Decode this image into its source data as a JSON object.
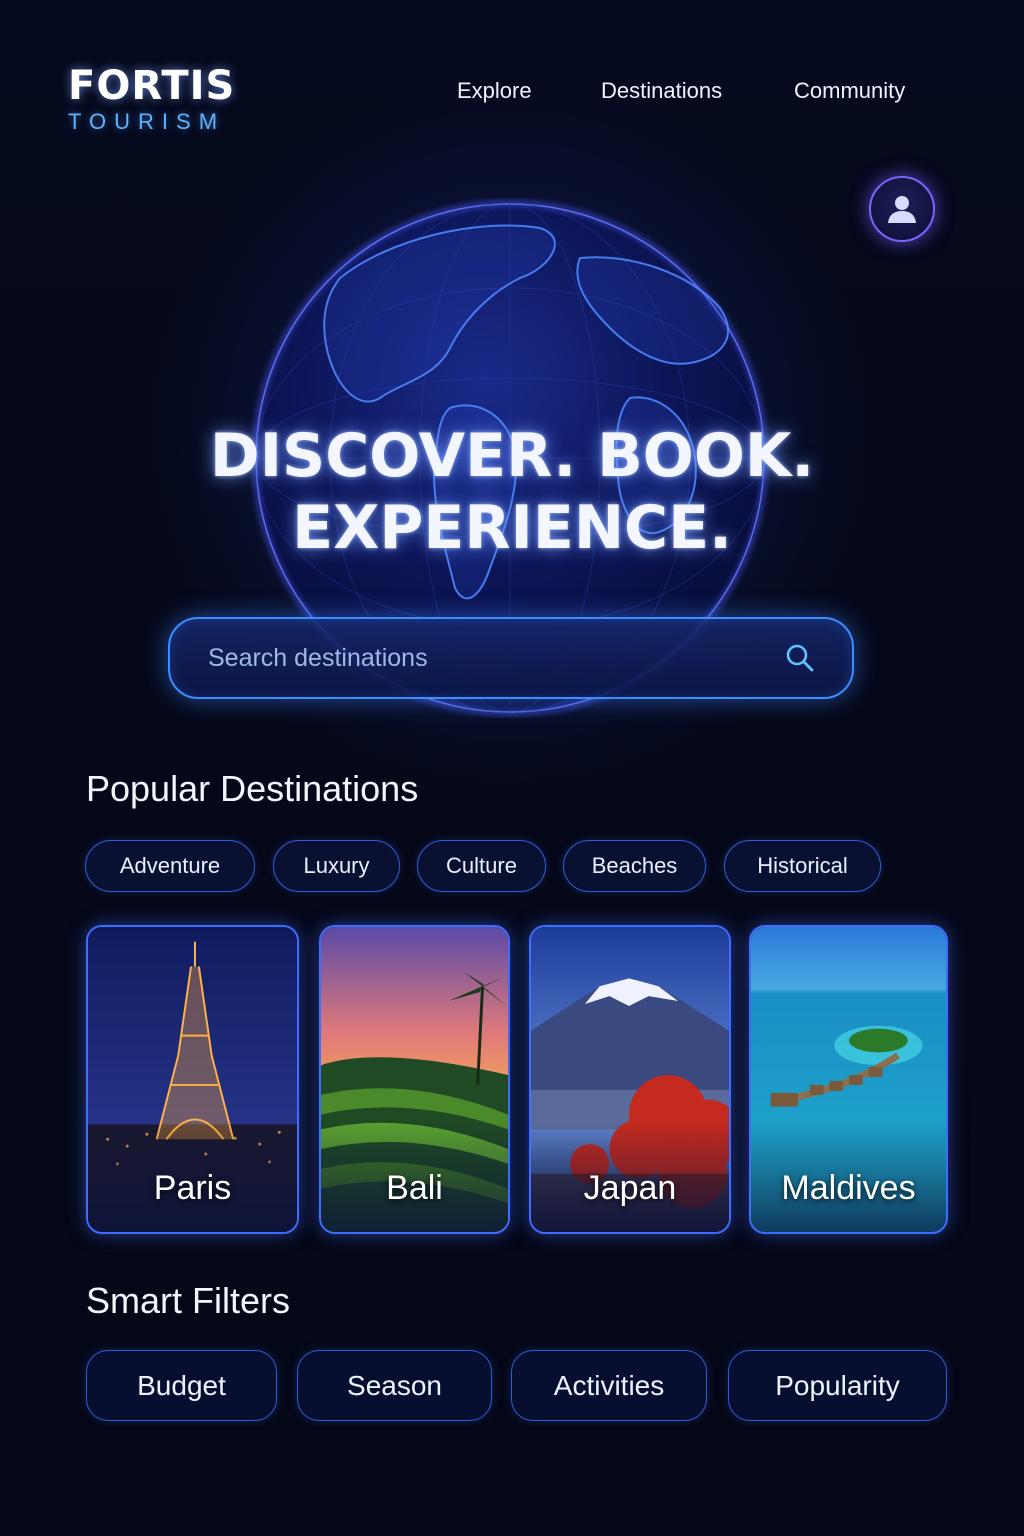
{
  "brand": {
    "name": "FORTIS",
    "tagline": "TOURISM"
  },
  "nav": {
    "items": [
      "Explore",
      "Destinations",
      "Community"
    ]
  },
  "hero": {
    "line1": "DISCOVER. BOOK.",
    "line2": "EXPERIENCE."
  },
  "search": {
    "placeholder": "Search destinations",
    "value": ""
  },
  "popular": {
    "title": "Popular Destinations",
    "categories": [
      "Adventure",
      "Luxury",
      "Culture",
      "Beaches",
      "Historical"
    ],
    "destinations": [
      {
        "name": "Paris",
        "image": "eiffel-tower-at-night"
      },
      {
        "name": "Bali",
        "image": "rice-terraces-sunset"
      },
      {
        "name": "Japan",
        "image": "mount-fuji-autumn"
      },
      {
        "name": "Maldives",
        "image": "overwater-villas-lagoon"
      }
    ]
  },
  "smart_filters": {
    "title": "Smart Filters",
    "items": [
      "Budget",
      "Season",
      "Activities",
      "Popularity"
    ]
  },
  "colors": {
    "background": "#050818",
    "accent": "#3d8dff",
    "brand_sub": "#5fb2ff",
    "avatar_ring": "#7a63ff"
  },
  "icons": {
    "search": "search-icon",
    "user": "user-icon",
    "globe": "globe-graphic"
  }
}
